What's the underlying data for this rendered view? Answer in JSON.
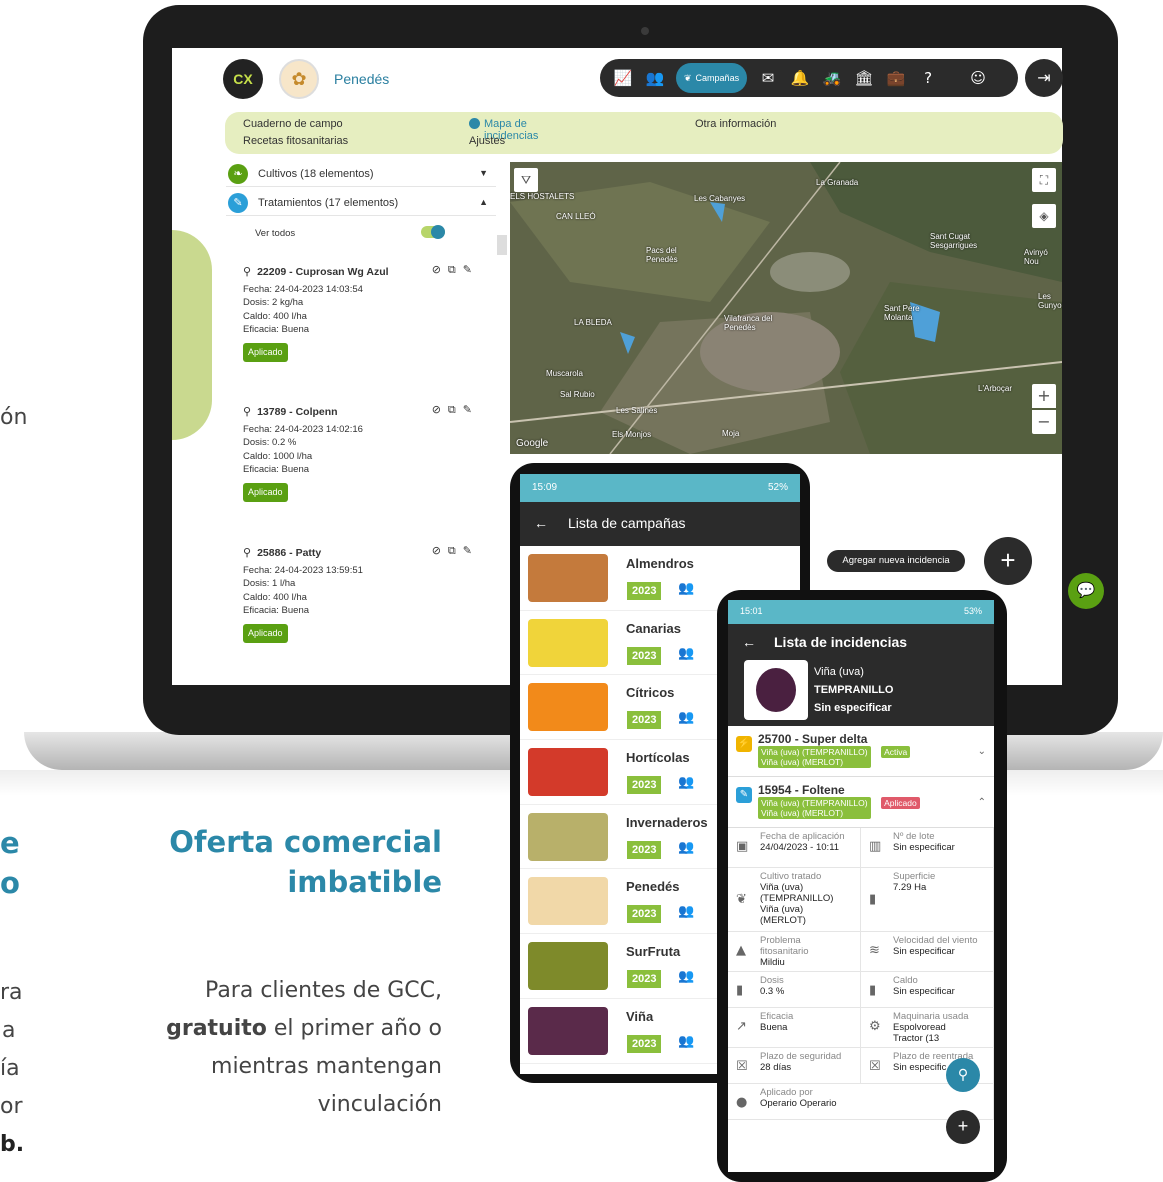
{
  "web": {
    "logo_text": "CX",
    "farm_name": "Penedés",
    "toolbar": {
      "chart_icon": "📈",
      "users_icon": "👥",
      "campaigns_label": "Campañas",
      "mail_icon": "✉",
      "bell_icon": "🔔",
      "tractor_icon": "🚜",
      "building_icon": "🏛",
      "kit_icon": "💼",
      "help_icon": "?",
      "account_icon": "☺",
      "logout_icon": "⇥"
    },
    "menu": {
      "item1": "Cuaderno de campo",
      "item2": "Recetas fitosanitarias",
      "item3": "Mapa de incidencias",
      "item4": "Ajustes",
      "item5": "Otra información"
    },
    "crops_label": "Cultivos (18 elementos)",
    "treatments_label": "Tratamientos (17 elementos)",
    "show_all_label": "Ver todos",
    "treatments": [
      {
        "title": "22209 - Cuprosan Wg Azul",
        "fecha": "Fecha: 24-04-2023 14:03:54",
        "dosis": "Dosis: 2 kg/ha",
        "caldo": "Caldo: 400 l/ha",
        "eficacia": "Eficacia: Buena",
        "status": "Aplicado"
      },
      {
        "title": "13789 - Colpenn",
        "fecha": "Fecha: 24-04-2023 14:02:16",
        "dosis": "Dosis: 0.2 %",
        "caldo": "Caldo: 1000 l/ha",
        "eficacia": "Eficacia: Buena",
        "status": "Aplicado"
      },
      {
        "title": "25886 - Patty",
        "fecha": "Fecha: 24-04-2023 13:59:51",
        "dosis": "Dosis: 1 l/ha",
        "caldo": "Caldo: 400 l/ha",
        "eficacia": "Eficacia: Buena",
        "status": "Aplicado"
      }
    ],
    "map_labels": {
      "l1": "La Granada",
      "l2": "Les Cabanyes",
      "l3": "Pacs del Penedès",
      "l4": "Vilafranca del Penedès",
      "l5": "Sant Pere Molanta",
      "l6": "Sant Cugat Sesgarrigues",
      "l7": "LA BLEDA",
      "l8": "Sant Cugat Sesgarrigues",
      "l9": "Els Monjos",
      "l10": "Moja",
      "l11": "L'Arboçar",
      "l12": "Les Salines",
      "l13": "Sal Rubio",
      "l14": "Muscarola",
      "l15": "ELS HOSTALETS",
      "l16": "CAN LLEÓ",
      "l17": "Avinyó Nou",
      "l18": "Les Gunyoles",
      "attribution": "Google"
    },
    "add_incident_label": "Agregar nueva incidencia",
    "add_icon": "+",
    "chat_icon": "💬"
  },
  "offer": {
    "heading_line1": "Oferta comercial",
    "heading_line2": "imbatible",
    "body_line1": "Para clientes de GCC,",
    "body_bold": "gratuito",
    "body_line2_rest": " el primer año o",
    "body_line3": "mientras mantengan",
    "body_line4": "vinculación",
    "left_frag_1": "ón",
    "left_frag_2": "e",
    "left_frag_3": "o",
    "left_frag_4": "ra",
    "left_frag_5": "a",
    "left_frag_6": "ía",
    "left_frag_7": "or",
    "left_frag_8": "b."
  },
  "phone1": {
    "status_time": "15:09",
    "status_battery": "52%",
    "title": "Lista de campañas",
    "back_icon": "←",
    "campaigns": [
      {
        "name": "Almendros",
        "year": "2023"
      },
      {
        "name": "Canarias",
        "year": "2023"
      },
      {
        "name": "Cítricos",
        "year": "2023"
      },
      {
        "name": "Hortícolas",
        "year": "2023"
      },
      {
        "name": "Invernaderos",
        "year": "2023"
      },
      {
        "name": "Penedés",
        "year": "2023"
      },
      {
        "name": "SurFruta",
        "year": "2023"
      },
      {
        "name": "Viña",
        "year": "2023"
      }
    ]
  },
  "phone2": {
    "status_time": "15:01",
    "status_battery": "53%",
    "title": "Lista de incidencias",
    "back_icon": "←",
    "crop_name": "Viña (uva)",
    "crop_variety": "TEMPRANILLO",
    "crop_extra": "Sin especificar",
    "incidents": [
      {
        "title": "25700 - Super delta",
        "tag1": "Viña (uva) (TEMPRANILLO)",
        "tag2": "Viña (uva) (MERLOT)",
        "status": "Activa"
      },
      {
        "title": "15954 - Foltene",
        "tag1": "Viña (uva) (TEMPRANILLO)",
        "tag2": "Viña (uva) (MERLOT)",
        "status": "Aplicado"
      }
    ],
    "details": {
      "fecha_k": "Fecha de aplicación",
      "fecha_v": "24/04/2023 - 10:11",
      "lote_k": "Nº de lote",
      "lote_v": "Sin especificar",
      "cultivo_k": "Cultivo tratado",
      "cultivo_v1": "Viña (uva)",
      "cultivo_v2": "(TEMPRANILLO)",
      "cultivo_v3": "Viña (uva)",
      "cultivo_v4": "(MERLOT)",
      "superficie_k": "Superficie",
      "superficie_v": "7.29 Ha",
      "problema_k1": "Problema",
      "problema_k2": "fitosanitario",
      "problema_v": "Mildiu",
      "viento_k": "Velocidad del viento",
      "viento_v": "Sin especificar",
      "dosis_k": "Dosis",
      "dosis_v": "0.3 %",
      "caldo_k": "Caldo",
      "caldo_v": "Sin especificar",
      "eficacia_k": "Eficacia",
      "eficacia_v": "Buena",
      "maquinaria_k": "Maquinaria usada",
      "maquinaria_v1": "Espolvoread",
      "maquinaria_v2": "Tractor (13",
      "plazo_k": "Plazo de seguridad",
      "plazo_v": "28 días",
      "reentrada_k": "Plazo de reentrada",
      "reentrada_v": "Sin especific",
      "aplicado_k": "Aplicado por",
      "aplicado_v": "Operario Operario"
    }
  }
}
